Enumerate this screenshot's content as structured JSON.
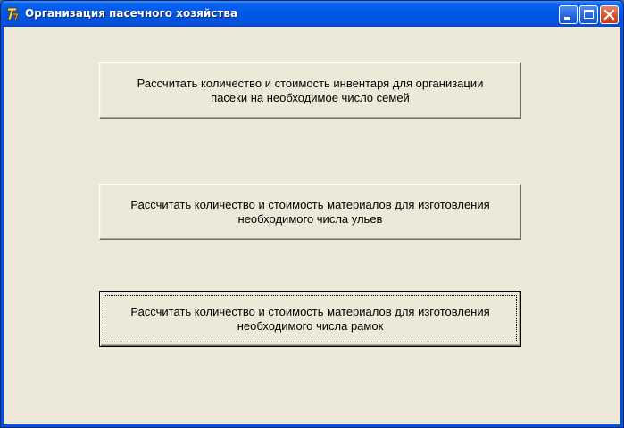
{
  "window": {
    "title": "Организация пасечного хозяйства",
    "icon": "delphi-app-icon",
    "controls": {
      "minimize_icon": "minimize-icon",
      "maximize_icon": "maximize-icon",
      "close_icon": "close-icon"
    }
  },
  "buttons": [
    {
      "line1": "Рассчитать количество и стоимость инвентаря для организации",
      "line2": "пасеки на необходимое число семей"
    },
    {
      "line1": "Рассчитать количество и стоимость материалов для изготовления",
      "line2": "необходимого числа ульев"
    },
    {
      "line1": "Рассчитать количество и стоимость материалов для изготовления",
      "line2": "необходимого числа рамок"
    }
  ],
  "colors": {
    "titlebar": "#0054e3",
    "client_bg": "#ece9d8",
    "close_button": "#d5522f"
  }
}
